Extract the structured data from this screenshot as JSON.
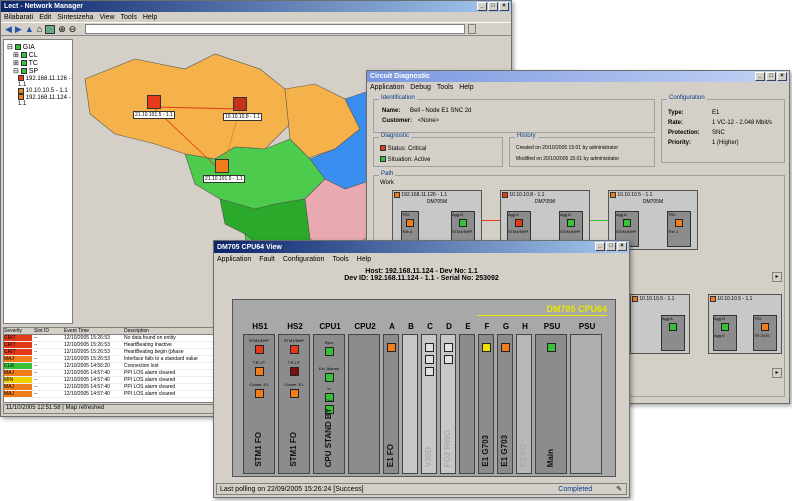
{
  "network_manager": {
    "title": "Lect - Network Manager",
    "menu": [
      "Bilabarati",
      "Edit",
      "Sintesizeha",
      "View",
      "Tools",
      "Help"
    ],
    "tree": [
      {
        "label": "GIA"
      },
      {
        "label": "CL"
      },
      {
        "label": "TC"
      },
      {
        "label": "SP"
      },
      {
        "label": "192.168.11.126 - 1.1"
      },
      {
        "label": "10.10.10.5 - 1.1"
      },
      {
        "label": "192.168.11.124 - 1.1"
      }
    ],
    "map_nodes": [
      {
        "label": "21.10.101.5 - 1.1",
        "color": "#e53a1a"
      },
      {
        "label": "10.10.10.8 - 1.1",
        "color": "#c43018"
      },
      {
        "label": "21.10.101.5 - 1.1",
        "color": "#f07c1a"
      }
    ],
    "log_headers": [
      "Severity",
      "Slot ID",
      "Event Time",
      "Description"
    ],
    "log_rows": [
      {
        "sev": "CRIT",
        "color": "#e53a1a",
        "id": "--",
        "time": "12/10/2005 15:26:53",
        "desc": "No data found on entity"
      },
      {
        "sev": "CRIT",
        "color": "#e53a1a",
        "id": "--",
        "time": "12/10/2005 15:26:53",
        "desc": "HeartBeating Inactive"
      },
      {
        "sev": "CRIT",
        "color": "#e53a1a",
        "id": "--",
        "time": "12/10/2005 15:26:53",
        "desc": "HeartBeating begin (phase"
      },
      {
        "sev": "MAJ",
        "color": "#f07c1a",
        "id": "--",
        "time": "12/10/2005 15:26:53",
        "desc": "Interface fails to a standard value"
      },
      {
        "sev": "CLR",
        "color": "#38c038",
        "id": "--",
        "time": "12/10/2005 14:56:20",
        "desc": "Connection lost"
      },
      {
        "sev": "MAJ",
        "color": "#f07c1a",
        "id": "--",
        "time": "12/10/2005 14:57:40",
        "desc": "PPI LOS alarm cleared"
      },
      {
        "sev": "MIN",
        "color": "#f0d000",
        "id": "--",
        "time": "12/10/2005 14:57:40",
        "desc": "PPI LOS alarm cleared"
      },
      {
        "sev": "MAJ",
        "color": "#f07c1a",
        "id": "--",
        "time": "12/10/2005 14:57:40",
        "desc": "PPI LOS alarm cleared"
      },
      {
        "sev": "MAJ",
        "color": "#f07c1a",
        "id": "--",
        "time": "12/10/2005 14:57:40",
        "desc": "PPI LOS alarm cleared"
      }
    ],
    "statusbar": "11/10/2005 12:51:58 | Map refreshed"
  },
  "circuit": {
    "title": "Circuit Diagnostic",
    "menu": [
      "Application",
      "Debug",
      "Tools",
      "Help"
    ],
    "ident_label": "Identification",
    "name_label": "Name:",
    "name_value": "Bell - Node E1 SNC 2d",
    "customer_label": "Customer:",
    "customer_value": "<None>",
    "config_label": "Configuration",
    "config": [
      {
        "k": "Type:",
        "v": "E1"
      },
      {
        "k": "Rate:",
        "v": "1 VC-12 - 2.048 Mbit/s"
      },
      {
        "k": "Protection:",
        "v": "SNC"
      },
      {
        "k": "Priority:",
        "v": "1 (Higher)"
      }
    ],
    "diag_label": "Diagnostic",
    "status": "Status: Critical",
    "situation": "Situation: Active",
    "history_label": "History",
    "created": "Created on 20/10/2005 15:01 by administrator",
    "modified": "Modified on 20/10/2005 15:01 by administrator",
    "path_label": "Path",
    "work_label": "Work",
    "nodes": [
      {
        "label": "192.168.11.126 - 1.1",
        "sub": "DM705M",
        "color": "#f07c1a"
      },
      {
        "label": "10.10.10.8 - 1.1",
        "sub": "DM705M",
        "color": "#e53a1a"
      },
      {
        "label": "10.10.10.5 - 1.1",
        "sub": "DM705M",
        "color": "#f07c1a"
      }
    ],
    "card_labels": [
      "TR2",
      "Agg B",
      "Agg A",
      "Agg B",
      "Agg A",
      "TR2"
    ],
    "port_labels": [
      "Trib A",
      "STM4/NHP",
      "STM4/NHP",
      "STM4/NHP",
      "STM4/NHP",
      "Trib 1"
    ],
    "path2_node": "10.10.10.5 - 1.1",
    "path2_node_b": "10.10.10.5 - 1.1",
    "path2_cards": [
      "Agg B",
      "Agg A",
      "TR2"
    ],
    "path2_bottom": [
      "Agg E",
      "Trib E",
      "TR 2470"
    ]
  },
  "cpu_view": {
    "title": "DM705 CPU64 View",
    "menu": [
      "Application",
      "Fault",
      "Configuration",
      "Tools",
      "Help"
    ],
    "host_line": "Host: 192.168.11.124 - Dev No: 1.1",
    "devid_line": "Dev ID: 192.168.11.124 - 1.1 - Serial No: 253092",
    "model": "DM705 CPU64",
    "slots": [
      "HS1",
      "HS2",
      "CPU1",
      "CPU2",
      "A",
      "B",
      "C",
      "D",
      "E",
      "F",
      "G",
      "H",
      "PSU",
      "PSU"
    ],
    "hs1_leds": [
      "STM1/NHP",
      "T.R.I.P.",
      "Comm. E1"
    ],
    "hs2_leds": [
      "STM1/NHP",
      "T.R.I.P.",
      "Comm. E1"
    ],
    "cpu_leds": [
      "Sync",
      "Ext. Alarms",
      "In",
      "Out"
    ],
    "slot_labels": [
      "STM1 FO",
      "STM1 FO",
      "CPU STAND BY",
      "E1 FO",
      "V35D",
      "FO2 RWO",
      "E1 G703",
      "E1 G703",
      "E1 FO",
      "Main"
    ],
    "status_text": "Last polling on 22/09/2005 15:26:24 [Success]",
    "status_right": "Completed"
  }
}
